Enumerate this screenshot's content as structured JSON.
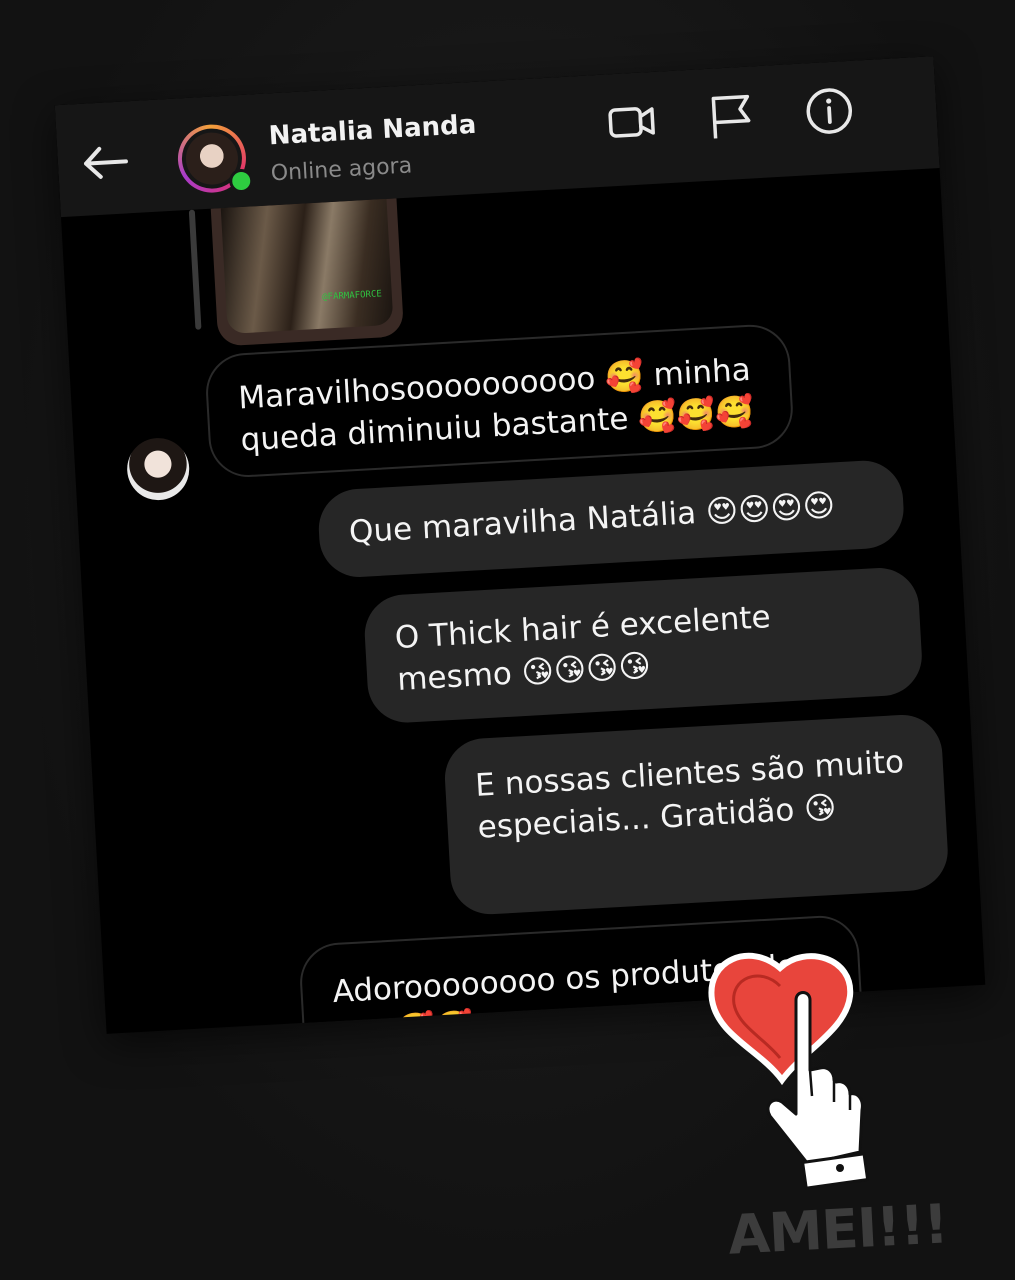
{
  "header": {
    "contact_name": "Natalia Nanda",
    "status": "Online agora",
    "icons": [
      "back-arrow-icon",
      "video-call-icon",
      "flag-icon",
      "info-icon"
    ]
  },
  "shared_photo": {
    "tag": "@FARMAFORCE"
  },
  "messages": [
    {
      "from": "contact",
      "text": "Maravilhosoooooooooo 🥰 minha queda diminuiu bastante 🥰🥰🥰"
    },
    {
      "from": "me",
      "text": "Que maravilha Natália 😍😍😍😍"
    },
    {
      "from": "me",
      "text": "O Thick hair é excelente mesmo 😘😘😘😘"
    },
    {
      "from": "me",
      "text": "E nossas clientes são muito especiais... Gratidão 😘"
    },
    {
      "from": "contact",
      "text": "Adoroooooooo os produtos de vcs 🥰🥰❤❤❤❤❤"
    }
  ],
  "sticker": {
    "caption": "AMEI!!!"
  },
  "colors": {
    "background": "#141414",
    "chat_bg": "#000000",
    "outgoing_bubble": "#262626",
    "online": "#2ecc40",
    "heart": "#e8453c"
  }
}
